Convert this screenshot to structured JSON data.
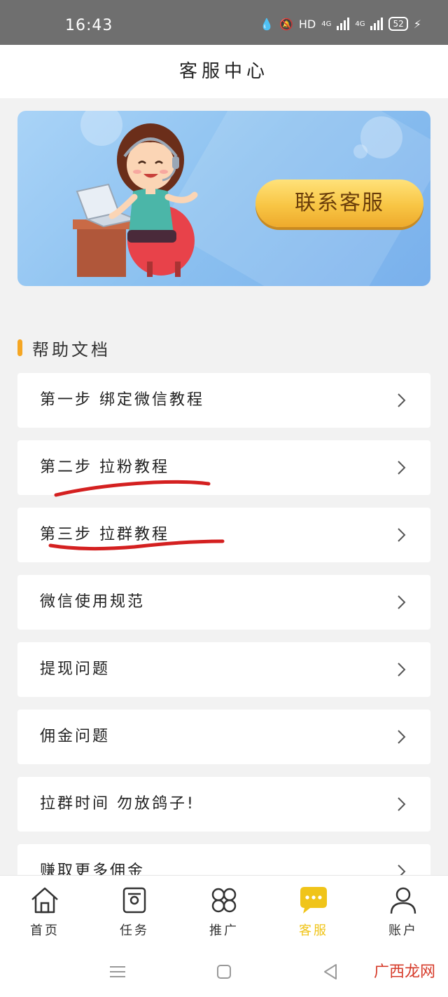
{
  "status_bar": {
    "time": "16:43",
    "hd": "HD",
    "net1": "4G",
    "net2": "4G",
    "battery": "52"
  },
  "header": {
    "title": "客服中心"
  },
  "banner": {
    "button_label": "联系客服"
  },
  "help": {
    "section_title": "帮助文档",
    "items": [
      {
        "label": "第一步 绑定微信教程"
      },
      {
        "label": "第二步 拉粉教程"
      },
      {
        "label": "第三步 拉群教程"
      },
      {
        "label": "微信使用规范"
      },
      {
        "label": "提现问题"
      },
      {
        "label": "佣金问题"
      },
      {
        "label": "拉群时间 勿放鸽子!"
      },
      {
        "label": "赚取更多佣金"
      }
    ]
  },
  "tabbar": {
    "tabs": [
      {
        "label": "首页",
        "icon": "home-icon"
      },
      {
        "label": "任务",
        "icon": "task-icon"
      },
      {
        "label": "推广",
        "icon": "promote-icon"
      },
      {
        "label": "客服",
        "icon": "chat-icon",
        "active": true
      },
      {
        "label": "账户",
        "icon": "user-icon"
      }
    ]
  },
  "watermark": {
    "text": "广西龙网"
  },
  "colors": {
    "accent": "#f0c419",
    "section_bar": "#f5a623",
    "scribble": "#d42020",
    "button": "#f8c544"
  }
}
